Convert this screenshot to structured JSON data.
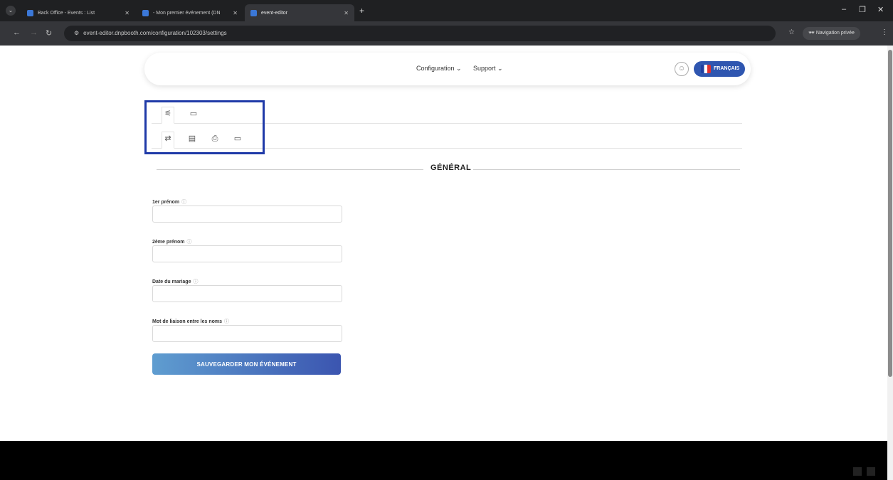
{
  "browser": {
    "tabs": [
      {
        "label": "Back Office - Events : List",
        "active": false
      },
      {
        "label": "- Mon premier événement (DN",
        "active": false
      },
      {
        "label": "event-editor",
        "active": true
      }
    ],
    "url": "event-editor.dnpbooth.com/configuration/102303/settings",
    "private_label": "Navigation privée"
  },
  "header": {
    "nav": [
      {
        "label": "Configuration ⌄"
      },
      {
        "label": "Support ⌄"
      }
    ],
    "language": "FRANÇAIS"
  },
  "section": {
    "title": "GÉNÉRAL"
  },
  "form": {
    "fields": [
      {
        "label": "1er prénom",
        "value": ""
      },
      {
        "label": "2ème prénom",
        "value": ""
      },
      {
        "label": "Date du mariage",
        "value": ""
      },
      {
        "label": "Mot de liaison entre les noms",
        "value": ""
      }
    ],
    "help_glyph": "ⓘ",
    "save_label": "SAUVEGARDER MON ÉVÉNEMENT"
  },
  "colors": {
    "accent": "#2f56b0",
    "highlight": "#1f3aa8"
  }
}
